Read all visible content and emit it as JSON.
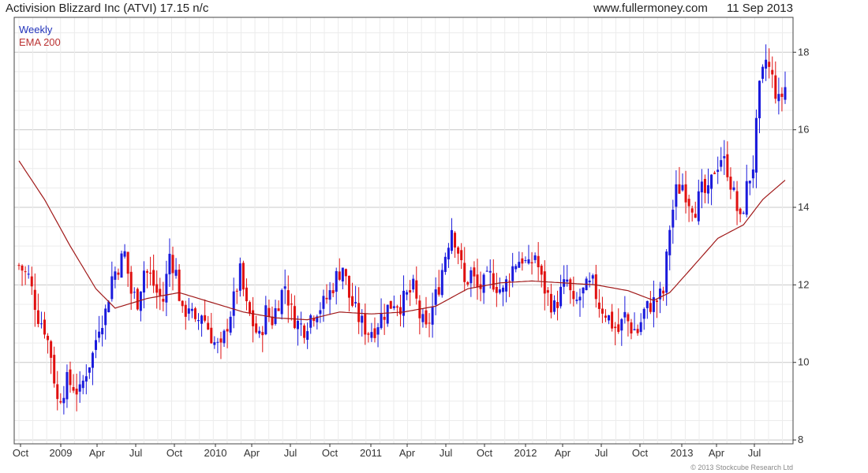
{
  "header": {
    "title": "Activision Blizzard Inc (ATVI) 17.15 n/c",
    "site": "www.fullermoney.com",
    "date": "11 Sep 2013"
  },
  "legend": {
    "weekly": "Weekly",
    "ema": "EMA 200"
  },
  "footer": {
    "copyright": "© 2013 Stockcube Research Ltd"
  },
  "colors": {
    "up": "#1a1adc",
    "down": "#e01010",
    "ema": "#a01818",
    "grid": "#d8d8d8",
    "axis": "#333333"
  },
  "chart_data": {
    "type": "candlestick",
    "title": "Activision Blizzard Inc (ATVI) 17.15 n/c",
    "interval": "Weekly",
    "x_tick_labels": [
      "Oct",
      "2009",
      "Apr",
      "Jul",
      "Oct",
      "2010",
      "Apr",
      "Jul",
      "Oct",
      "2011",
      "Apr",
      "Jul",
      "Oct",
      "2012",
      "Apr",
      "Jul",
      "Oct",
      "2013",
      "Apr",
      "Jul"
    ],
    "y_tick_labels": [
      "8",
      "10",
      "12",
      "14",
      "16",
      "18"
    ],
    "ylim": [
      7.9,
      18.9
    ],
    "grid": true,
    "y_axis_side": "right",
    "anchor_closes": [
      {
        "week": 0,
        "close": 12.5
      },
      {
        "week": 3,
        "close": 12.2
      },
      {
        "week": 6,
        "close": 11.2
      },
      {
        "week": 8,
        "close": 10.9
      },
      {
        "week": 10,
        "close": 10.2
      },
      {
        "week": 12,
        "close": 9.0
      },
      {
        "week": 15,
        "close": 9.5
      },
      {
        "week": 17,
        "close": 9.4
      },
      {
        "week": 19,
        "close": 9.2
      },
      {
        "week": 21,
        "close": 9.8
      },
      {
        "week": 23,
        "close": 10.2
      },
      {
        "week": 25,
        "close": 11.0
      },
      {
        "week": 27,
        "close": 11.3
      },
      {
        "week": 29,
        "close": 12.2
      },
      {
        "week": 31,
        "close": 12.5
      },
      {
        "week": 33,
        "close": 12.8
      },
      {
        "week": 35,
        "close": 11.8
      },
      {
        "week": 37,
        "close": 11.6
      },
      {
        "week": 39,
        "close": 12.4
      },
      {
        "week": 41,
        "close": 12.2
      },
      {
        "week": 43,
        "close": 11.8
      },
      {
        "week": 45,
        "close": 11.6
      },
      {
        "week": 47,
        "close": 12.8
      },
      {
        "week": 49,
        "close": 12.3
      },
      {
        "week": 51,
        "close": 11.2
      },
      {
        "week": 53,
        "close": 11.5
      },
      {
        "week": 55,
        "close": 10.9
      },
      {
        "week": 57,
        "close": 11.3
      },
      {
        "week": 59,
        "close": 10.9
      },
      {
        "week": 61,
        "close": 10.5
      },
      {
        "week": 63,
        "close": 10.3
      },
      {
        "week": 65,
        "close": 11.0
      },
      {
        "week": 67,
        "close": 11.6
      },
      {
        "week": 69,
        "close": 12.3
      },
      {
        "week": 71,
        "close": 11.4
      },
      {
        "week": 73,
        "close": 11.0
      },
      {
        "week": 75,
        "close": 10.6
      },
      {
        "week": 77,
        "close": 11.3
      },
      {
        "week": 79,
        "close": 11.1
      },
      {
        "week": 81,
        "close": 11.6
      },
      {
        "week": 83,
        "close": 12.0
      },
      {
        "week": 85,
        "close": 11.3
      },
      {
        "week": 87,
        "close": 11.0
      },
      {
        "week": 89,
        "close": 10.9
      },
      {
        "week": 91,
        "close": 11.2
      },
      {
        "week": 93,
        "close": 11.4
      },
      {
        "week": 95,
        "close": 11.5
      },
      {
        "week": 97,
        "close": 11.8
      },
      {
        "week": 99,
        "close": 12.2
      },
      {
        "week": 101,
        "close": 12.5
      },
      {
        "week": 103,
        "close": 11.7
      },
      {
        "week": 105,
        "close": 11.3
      },
      {
        "week": 107,
        "close": 11.0
      },
      {
        "week": 109,
        "close": 10.8
      },
      {
        "week": 111,
        "close": 10.9
      },
      {
        "week": 113,
        "close": 11.2
      },
      {
        "week": 115,
        "close": 11.4
      },
      {
        "week": 117,
        "close": 11.6
      },
      {
        "week": 119,
        "close": 11.5
      },
      {
        "week": 121,
        "close": 11.7
      },
      {
        "week": 123,
        "close": 11.9
      },
      {
        "week": 125,
        "close": 11.2
      },
      {
        "week": 127,
        "close": 10.8
      },
      {
        "week": 129,
        "close": 11.4
      },
      {
        "week": 131,
        "close": 12.0
      },
      {
        "week": 133,
        "close": 12.8
      },
      {
        "week": 135,
        "close": 13.5
      },
      {
        "week": 137,
        "close": 12.9
      },
      {
        "week": 139,
        "close": 12.0
      },
      {
        "week": 141,
        "close": 12.3
      },
      {
        "week": 143,
        "close": 11.9
      },
      {
        "week": 145,
        "close": 12.0
      },
      {
        "week": 147,
        "close": 12.2
      },
      {
        "week": 149,
        "close": 12.0
      },
      {
        "week": 151,
        "close": 11.8
      },
      {
        "week": 153,
        "close": 12.3
      },
      {
        "week": 155,
        "close": 12.6
      },
      {
        "week": 157,
        "close": 12.7
      },
      {
        "week": 159,
        "close": 12.4
      },
      {
        "week": 161,
        "close": 12.8
      },
      {
        "week": 163,
        "close": 12.1
      },
      {
        "week": 165,
        "close": 11.7
      },
      {
        "week": 167,
        "close": 11.4
      },
      {
        "week": 169,
        "close": 11.8
      },
      {
        "week": 171,
        "close": 12.1
      },
      {
        "week": 173,
        "close": 11.4
      },
      {
        "week": 175,
        "close": 11.7
      },
      {
        "week": 177,
        "close": 11.9
      },
      {
        "week": 179,
        "close": 12.0
      },
      {
        "week": 181,
        "close": 11.5
      },
      {
        "week": 183,
        "close": 11.3
      },
      {
        "week": 185,
        "close": 11.0
      },
      {
        "week": 187,
        "close": 10.8
      },
      {
        "week": 189,
        "close": 11.2
      },
      {
        "week": 191,
        "close": 10.9
      },
      {
        "week": 193,
        "close": 10.8
      },
      {
        "week": 195,
        "close": 11.3
      },
      {
        "week": 197,
        "close": 11.5
      },
      {
        "week": 199,
        "close": 11.6
      },
      {
        "week": 201,
        "close": 11.8
      },
      {
        "week": 203,
        "close": 13.5
      },
      {
        "week": 205,
        "close": 14.4
      },
      {
        "week": 207,
        "close": 14.6
      },
      {
        "week": 209,
        "close": 14.2
      },
      {
        "week": 211,
        "close": 14.0
      },
      {
        "week": 213,
        "close": 14.4
      },
      {
        "week": 215,
        "close": 14.3
      },
      {
        "week": 217,
        "close": 15.0
      },
      {
        "week": 219,
        "close": 15.3
      },
      {
        "week": 221,
        "close": 15.0
      },
      {
        "week": 223,
        "close": 14.3
      },
      {
        "week": 225,
        "close": 13.6
      },
      {
        "week": 227,
        "close": 14.5
      },
      {
        "week": 229,
        "close": 15.1
      },
      {
        "week": 231,
        "close": 17.0
      },
      {
        "week": 233,
        "close": 17.8
      },
      {
        "week": 235,
        "close": 17.3
      },
      {
        "week": 237,
        "close": 16.7
      },
      {
        "week": 239,
        "close": 17.1
      }
    ],
    "ema_label": "EMA 200",
    "ema_anchors": [
      {
        "week": 0,
        "value": 15.2
      },
      {
        "week": 8,
        "value": 14.2
      },
      {
        "week": 16,
        "value": 13.0
      },
      {
        "week": 24,
        "value": 11.9
      },
      {
        "week": 30,
        "value": 11.4
      },
      {
        "week": 40,
        "value": 11.65
      },
      {
        "week": 50,
        "value": 11.8
      },
      {
        "week": 60,
        "value": 11.55
      },
      {
        "week": 70,
        "value": 11.3
      },
      {
        "week": 80,
        "value": 11.15
      },
      {
        "week": 90,
        "value": 11.1
      },
      {
        "week": 100,
        "value": 11.3
      },
      {
        "week": 110,
        "value": 11.25
      },
      {
        "week": 120,
        "value": 11.3
      },
      {
        "week": 130,
        "value": 11.45
      },
      {
        "week": 140,
        "value": 11.9
      },
      {
        "week": 150,
        "value": 12.05
      },
      {
        "week": 160,
        "value": 12.1
      },
      {
        "week": 170,
        "value": 12.05
      },
      {
        "week": 180,
        "value": 12.0
      },
      {
        "week": 190,
        "value": 11.85
      },
      {
        "week": 198,
        "value": 11.6
      },
      {
        "week": 203,
        "value": 11.8
      },
      {
        "week": 210,
        "value": 12.45
      },
      {
        "week": 218,
        "value": 13.2
      },
      {
        "week": 226,
        "value": 13.55
      },
      {
        "week": 232,
        "value": 14.2
      },
      {
        "week": 239,
        "value": 14.7
      }
    ]
  }
}
